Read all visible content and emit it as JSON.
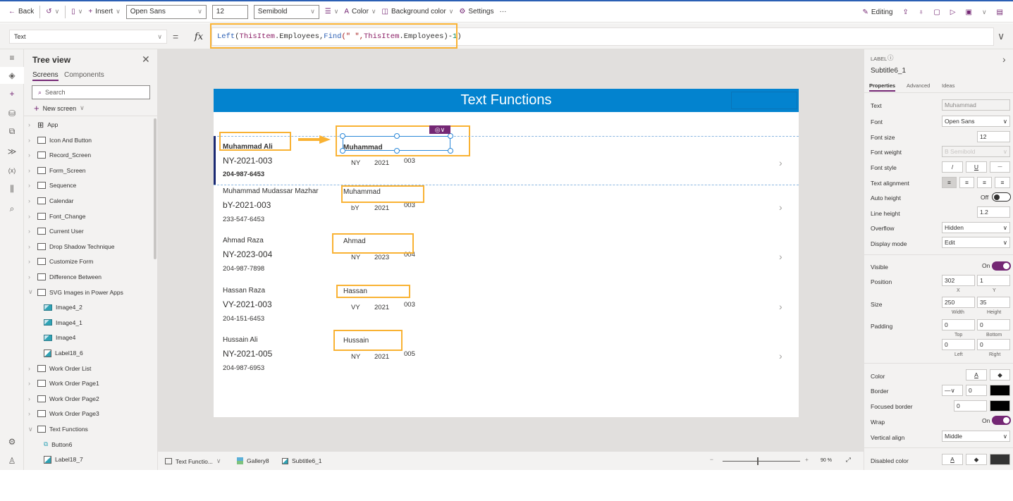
{
  "toolbar": {
    "back": "Back",
    "insert": "Insert",
    "font": "Open Sans",
    "font_size": "12",
    "font_weight": "Semibold",
    "color": "Color",
    "background_color": "Background color",
    "settings": "Settings",
    "more": "···",
    "editing": "Editing"
  },
  "formula_bar": {
    "property": "Text",
    "equals": "=",
    "fx": "fx",
    "formula_parts": [
      "Left",
      "(",
      "ThisItem",
      ".Employees,",
      "Find",
      "(\" \",",
      "ThisItem",
      ".Employees)-",
      "1",
      ")"
    ]
  },
  "tree": {
    "title": "Tree view",
    "tabs": [
      "Screens",
      "Components"
    ],
    "search_placeholder": "Search",
    "new_screen": "New screen",
    "items": [
      {
        "label": "App",
        "type": "app",
        "expanded": false
      },
      {
        "label": "Icon And Button",
        "type": "screen"
      },
      {
        "label": "Record_Screen",
        "type": "screen"
      },
      {
        "label": "Form_Screen",
        "type": "screen"
      },
      {
        "label": "Sequence",
        "type": "screen"
      },
      {
        "label": "Calendar",
        "type": "screen"
      },
      {
        "label": "Font_Change",
        "type": "screen"
      },
      {
        "label": "Current User",
        "type": "screen"
      },
      {
        "label": "Drop Shadow Technique",
        "type": "screen"
      },
      {
        "label": "Customize Form",
        "type": "screen"
      },
      {
        "label": "Difference Between",
        "type": "screen"
      },
      {
        "label": "SVG Images in Power Apps",
        "type": "screen",
        "expanded": true
      },
      {
        "label": "Image4_2",
        "type": "image",
        "child": true
      },
      {
        "label": "Image4_1",
        "type": "image",
        "child": true
      },
      {
        "label": "Image4",
        "type": "image",
        "child": true
      },
      {
        "label": "Label18_6",
        "type": "label",
        "child": true
      },
      {
        "label": "Work Order List",
        "type": "screen"
      },
      {
        "label": "Work Order Page1",
        "type": "screen"
      },
      {
        "label": "Work Order Page2",
        "type": "screen"
      },
      {
        "label": "Work Order Page3",
        "type": "screen"
      },
      {
        "label": "Text Functions",
        "type": "screen",
        "expanded": true
      },
      {
        "label": "Button6",
        "type": "button",
        "child": true
      },
      {
        "label": "Label18_7",
        "type": "label",
        "child": true
      }
    ]
  },
  "screen": {
    "title": "Text Functions",
    "rows": [
      {
        "name": "Muhammad Ali",
        "code": "NY-2021-003",
        "phone": "204-987-6453",
        "first": "Muhammad",
        "p1": "NY",
        "p2": "2021",
        "p3": "003",
        "selected": true
      },
      {
        "name": "Muhammad Mudassar Mazhar",
        "code": "bY-2021-003",
        "phone": "233-547-6453",
        "first": "Muhammad",
        "p1": "bY",
        "p2": "2021",
        "p3": "003"
      },
      {
        "name": "Ahmad Raza",
        "code": "NY-2023-004",
        "phone": "204-987-7898",
        "first": "Ahmad",
        "p1": "NY",
        "p2": "2023",
        "p3": "004"
      },
      {
        "name": "Hassan Raza",
        "code": "VY-2021-003",
        "phone": "204-151-6453",
        "first": "Hassan",
        "p1": "VY",
        "p2": "2021",
        "p3": "003"
      },
      {
        "name": "Hussain Ali",
        "code": "NY-2021-005",
        "phone": "204-987-6953",
        "first": "Hussain",
        "p1": "NY",
        "p2": "2021",
        "p3": "005"
      }
    ]
  },
  "properties": {
    "type": "LABEL",
    "name": "Subtitle6_1",
    "tabs": [
      "Properties",
      "Advanced",
      "Ideas"
    ],
    "text": {
      "label": "Text",
      "value": "Muhammad"
    },
    "font": {
      "label": "Font",
      "value": "Open Sans"
    },
    "font_size": {
      "label": "Font size",
      "value": "12"
    },
    "font_weight": {
      "label": "Font weight",
      "value": "B  Semibold"
    },
    "font_style": {
      "label": "Font style",
      "buttons": [
        "/",
        "U",
        "—"
      ]
    },
    "text_alignment": {
      "label": "Text alignment"
    },
    "auto_height": {
      "label": "Auto height",
      "value": "Off"
    },
    "line_height": {
      "label": "Line height",
      "value": "1.2"
    },
    "overflow": {
      "label": "Overflow",
      "value": "Hidden"
    },
    "display_mode": {
      "label": "Display mode",
      "value": "Edit"
    },
    "visible": {
      "label": "Visible",
      "value": "On"
    },
    "position": {
      "label": "Position",
      "x": "302",
      "y": "1",
      "x_cap": "X",
      "y_cap": "Y"
    },
    "size": {
      "label": "Size",
      "width": "250",
      "height": "35",
      "w_cap": "Width",
      "h_cap": "Height"
    },
    "padding": {
      "label": "Padding",
      "top": "0",
      "bottom": "0",
      "left": "0",
      "right": "0",
      "top_cap": "Top",
      "bottom_cap": "Bottom",
      "left_cap": "Left",
      "right_cap": "Right"
    },
    "color": {
      "label": "Color"
    },
    "border": {
      "label": "Border",
      "value": "0",
      "color": "#000000"
    },
    "focused_border": {
      "label": "Focused border",
      "value": "0",
      "color": "#000000"
    },
    "wrap": {
      "label": "Wrap",
      "value": "On"
    },
    "vertical_align": {
      "label": "Vertical align",
      "value": "Middle"
    },
    "disabled_color": {
      "label": "Disabled color",
      "color": "#333333"
    }
  },
  "status": {
    "screen": "Text Functio...",
    "gallery": "Gallery8",
    "control": "Subtitle6_1",
    "zoom": "90",
    "zoom_unit": "%"
  },
  "colors": {
    "accent": "#742774",
    "header": "#0383cf",
    "highlight": "#f9b233"
  }
}
